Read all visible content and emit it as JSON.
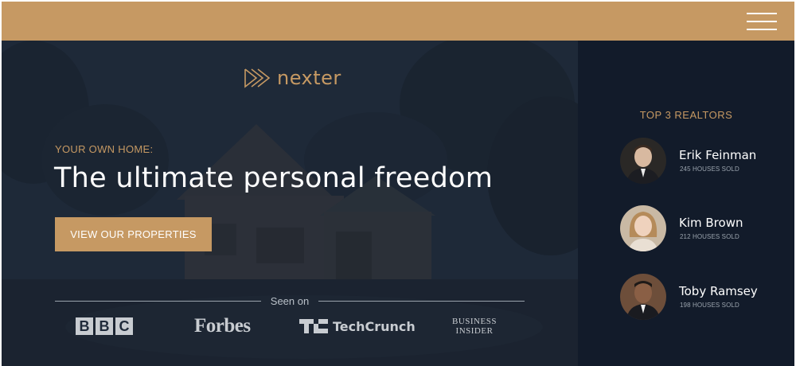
{
  "header": {
    "menu_icon": "hamburger-menu-icon",
    "accent_color": "#c69963"
  },
  "hero": {
    "logo_text": "nexter",
    "logo_icon": "triple-play-arrow-icon",
    "eyebrow": "Your own home:",
    "headline": "The ultimate personal freedom",
    "cta_label": "View our properties",
    "seen_on_label": "Seen on",
    "press": {
      "bbc": [
        "B",
        "B",
        "C"
      ],
      "forbes": "Forbes",
      "techcrunch": "TechCrunch",
      "business_insider_line1": "Business",
      "business_insider_line2": "Insider"
    }
  },
  "realtors": {
    "title": "Top 3 Realtors",
    "items": [
      {
        "name": "Erik Feinman",
        "sold": "245 houses sold"
      },
      {
        "name": "Kim Brown",
        "sold": "212 houses sold"
      },
      {
        "name": "Toby Ramsey",
        "sold": "198 houses sold"
      }
    ]
  },
  "colors": {
    "gold": "#c69963",
    "navy": "#121b2a",
    "hero_overlay": "#1f2a3a",
    "white": "#ffffff"
  }
}
